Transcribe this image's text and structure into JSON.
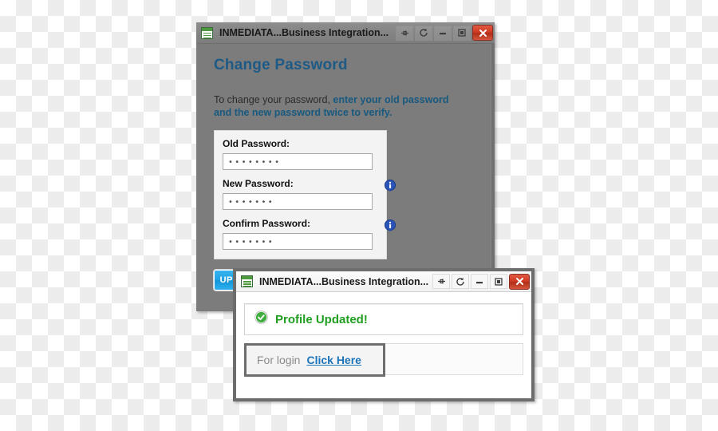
{
  "change_password_window": {
    "titlebar": {
      "app_icon": "document-list-icon",
      "title": "INMEDIATA...Business Integration...",
      "buttons": [
        {
          "name": "pin",
          "icon": "pin-icon",
          "label": ""
        },
        {
          "name": "refresh",
          "icon": "refresh-icon",
          "label": ""
        },
        {
          "name": "minimize",
          "icon": "minimize-icon",
          "label": ""
        },
        {
          "name": "maximize",
          "icon": "maximize-icon",
          "label": ""
        },
        {
          "name": "close",
          "icon": "close-icon",
          "label": ""
        }
      ]
    },
    "page_title": "Change Password",
    "instructions": {
      "lead": "To change your password, ",
      "emphasis": "enter your old password and the new password twice to verify."
    },
    "fields": [
      {
        "label": "Old Password:",
        "value": "••••••••",
        "has_info_icon": false
      },
      {
        "label": "New Password:",
        "value": "•••••••",
        "has_info_icon": true
      },
      {
        "label": "Confirm Password:",
        "value": "•••••••",
        "has_info_icon": true
      }
    ],
    "update_button": {
      "label": "UPDATE",
      "icon": "refresh-spinner-icon"
    },
    "colors": {
      "title_accent": "#1e5a86",
      "instruction_accent": "#17597f",
      "button_blue": "#21a3e5",
      "window_body": "#7c7c7c"
    }
  },
  "profile_updated_window": {
    "titlebar": {
      "app_icon": "document-list-icon",
      "title": "INMEDIATA...Business Integration...",
      "buttons": [
        {
          "name": "pin",
          "icon": "pin-icon",
          "label": ""
        },
        {
          "name": "refresh",
          "icon": "refresh-icon",
          "label": ""
        },
        {
          "name": "minimize",
          "icon": "minimize-icon",
          "label": ""
        },
        {
          "name": "maximize",
          "icon": "maximize-icon",
          "label": ""
        },
        {
          "name": "close",
          "icon": "close-icon",
          "label": ""
        }
      ]
    },
    "status": {
      "icon": "success-check-icon",
      "text": "Profile Updated!"
    },
    "login_row": {
      "label": "For login",
      "link_text": "Click Here"
    },
    "colors": {
      "success_green": "#1f9e1f",
      "link_blue": "#1c74b8",
      "frame_gray": "#6d6d6d"
    }
  }
}
